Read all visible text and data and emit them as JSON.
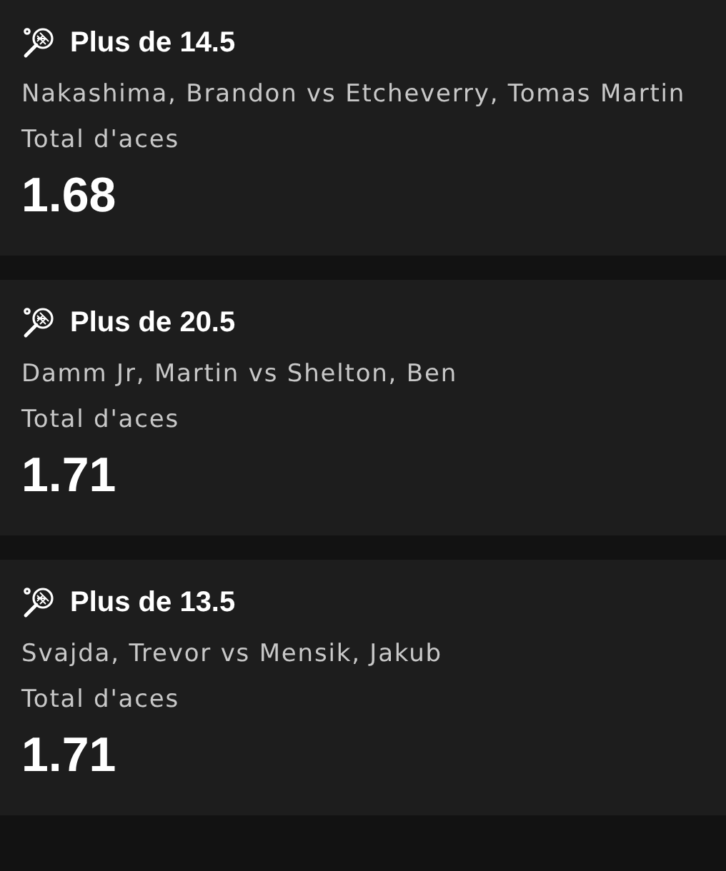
{
  "bets": [
    {
      "selection": "Plus de 14.5",
      "match": "Nakashima, Brandon vs Etcheverry, Tomas Martin",
      "market": "Total d'aces",
      "odds": "1.68"
    },
    {
      "selection": "Plus de 20.5",
      "match": "Damm Jr, Martin vs Shelton, Ben",
      "market": "Total d'aces",
      "odds": "1.71"
    },
    {
      "selection": "Plus de 13.5",
      "match": "Svajda, Trevor vs Mensik, Jakub",
      "market": "Total d'aces",
      "odds": "1.71"
    }
  ]
}
